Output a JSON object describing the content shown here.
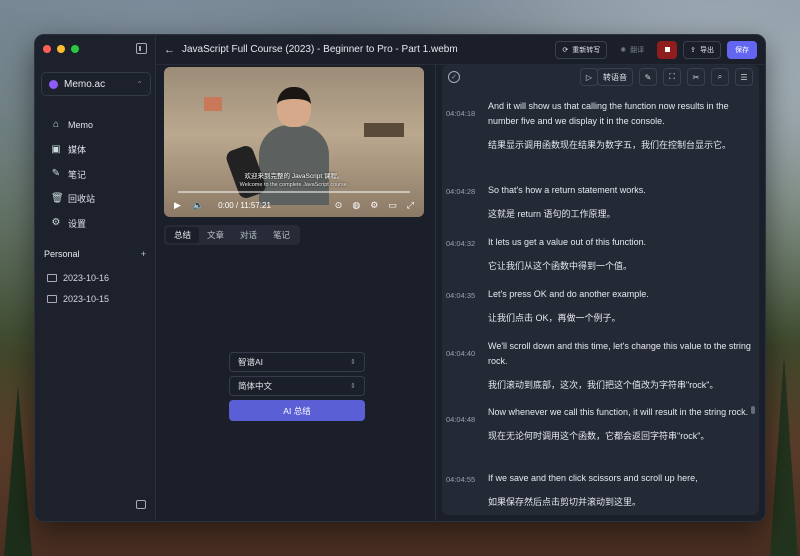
{
  "app": {
    "workspace_name": "Memo.ac",
    "title": "JavaScript Full Course (2023) - Beginner to Pro - Part 1.webm"
  },
  "colors": {
    "accent": "#6366f1",
    "stop": "#8f1d1d",
    "workspace_dot": "#8b5cf6"
  },
  "sidebar": {
    "items": [
      {
        "label": "Memo",
        "icon": "home-icon"
      },
      {
        "label": "媒体",
        "icon": "media-icon"
      },
      {
        "label": "笔记",
        "icon": "note-icon"
      },
      {
        "label": "回收站",
        "icon": "trash-icon"
      },
      {
        "label": "设置",
        "icon": "gear-icon"
      }
    ],
    "section_label": "Personal",
    "add_icon": "plus-icon",
    "folders": [
      "2023-10-16",
      "2023-10-15"
    ]
  },
  "toolbar": {
    "rewrite_label": "重新转写",
    "translate_label": "翻译",
    "export_label": "导出",
    "save_label": "保存"
  },
  "video": {
    "subtitle_zh": "欢迎来到完整的 JavaScript 课程。",
    "subtitle_en": "Welcome to the complete JavaScript course.",
    "time": "0:00 / 11:57:21"
  },
  "tabs": [
    "总结",
    "文章",
    "对话",
    "笔记"
  ],
  "summary": {
    "model": "智谱AI",
    "language": "简体中文",
    "button": "AI 总结"
  },
  "transcript_toolbar": {
    "convert_label": "转语音"
  },
  "transcript": [
    {
      "ts": "04:04:18",
      "en": "And it will show us that calling the function now results in the number five and we display it in the console.",
      "zh": "结果显示调用函数现在结果为数字五，我们在控制台显示它。"
    },
    {
      "ts": "04:04:28",
      "en": "So that's how a return statement works.",
      "zh": "这就是 return 语句的工作原理。"
    },
    {
      "ts": "04:04:32",
      "en": "It lets us get a value out of this function.",
      "zh": "它让我们从这个函数中得到一个值。"
    },
    {
      "ts": "04:04:35",
      "en": "Let's press OK and do another example.",
      "zh": "让我们点击 OK，再做一个例子。"
    },
    {
      "ts": "04:04:40",
      "en": "We'll scroll down and this time, let's change this value to the string rock.",
      "zh": "我们滚动到底部，这次，我们把这个值改为字符串\"rock\"。"
    },
    {
      "ts": "04:04:48",
      "en": "Now whenever we call this function, it will result in the string rock.",
      "zh": "现在无论何时调用这个函数，它都会返回字符串\"rock\"。"
    },
    {
      "ts": "04:04:55",
      "en": "If we save and then click scissors and scroll up here,",
      "zh": "如果保存然后点击剪切并滚动到这里。"
    }
  ]
}
